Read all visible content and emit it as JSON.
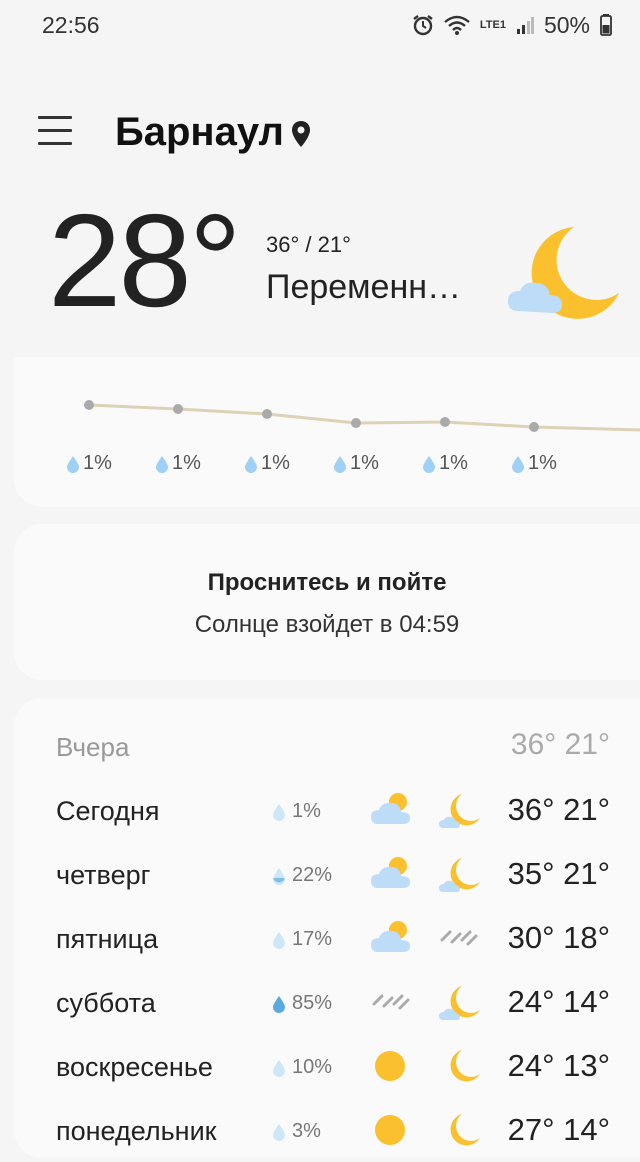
{
  "status_bar": {
    "time": "22:56",
    "network": "LTE1",
    "battery": "50%"
  },
  "header": {
    "city": "Барнаул"
  },
  "current": {
    "temperature": "28°",
    "hi_lo": "36° / 21°",
    "condition": "Переменн…"
  },
  "hourly": {
    "precip": [
      "1%",
      "1%",
      "1%",
      "1%",
      "1%",
      "1%"
    ]
  },
  "sun": {
    "title": "Проснитесь и пойте",
    "subtitle": "Солнце взойдет в 04:59"
  },
  "daily": [
    {
      "name": "Вчера",
      "precip": "",
      "temps": "36° 21°",
      "day_icon": "",
      "night_icon": ""
    },
    {
      "name": "Сегодня",
      "precip": "1%",
      "temps": "36° 21°",
      "day_icon": "partly-cloudy-icon",
      "night_icon": "night-partly-cloudy-icon"
    },
    {
      "name": "четверг",
      "precip": "22%",
      "temps": "35° 21°",
      "day_icon": "partly-cloudy-icon",
      "night_icon": "night-partly-cloudy-icon"
    },
    {
      "name": "пятница",
      "precip": "17%",
      "temps": "30° 18°",
      "day_icon": "partly-cloudy-icon",
      "night_icon": "rain-icon"
    },
    {
      "name": "суббота",
      "precip": "85%",
      "temps": "24° 14°",
      "day_icon": "rain-icon",
      "night_icon": "night-partly-cloudy-icon"
    },
    {
      "name": "воскресенье",
      "precip": "10%",
      "temps": "24° 13°",
      "day_icon": "sun-icon",
      "night_icon": "moon-icon"
    },
    {
      "name": "понедельник",
      "precip": "3%",
      "temps": "27° 14°",
      "day_icon": "sun-icon",
      "night_icon": "moon-icon"
    }
  ],
  "colors": {
    "accent_yellow": "#fbc02d",
    "cloud_blue": "#bcdcf7",
    "drop_blue": "#9fd0f5"
  }
}
